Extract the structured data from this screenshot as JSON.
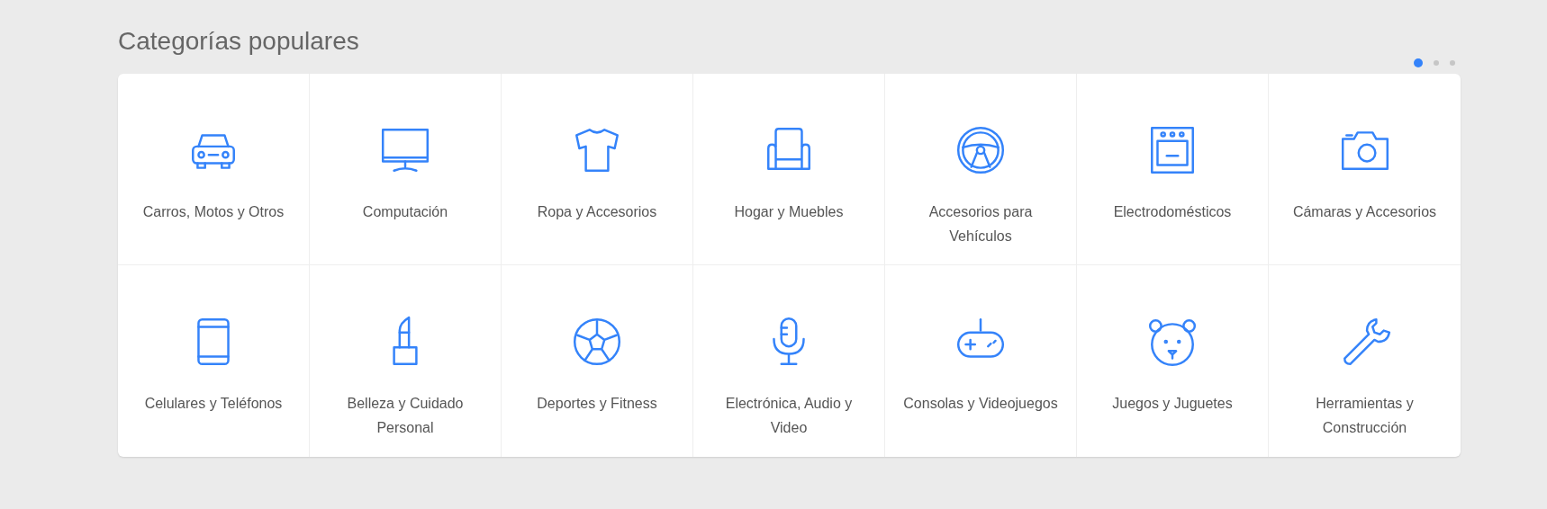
{
  "title": "Categorías populares",
  "pager": [
    {
      "selected": true
    },
    {
      "selected": false
    },
    {
      "selected": false
    }
  ],
  "categories": [
    {
      "label": "Carros, Motos y Otros"
    },
    {
      "label": "Computación"
    },
    {
      "label": "Ropa y Accesorios"
    },
    {
      "label": "Hogar y Muebles"
    },
    {
      "label": "Accesorios para Vehículos"
    },
    {
      "label": "Electrodomésticos"
    },
    {
      "label": "Cámaras y Accesorios"
    },
    {
      "label": "Celulares y Teléfonos"
    },
    {
      "label": "Belleza y Cuidado Personal"
    },
    {
      "label": "Deportes y Fitness"
    },
    {
      "label": "Electrónica, Audio y Video"
    },
    {
      "label": "Consolas y Videojuegos"
    },
    {
      "label": "Juegos y Juguetes"
    },
    {
      "label": "Herramientas y Construcción"
    }
  ]
}
